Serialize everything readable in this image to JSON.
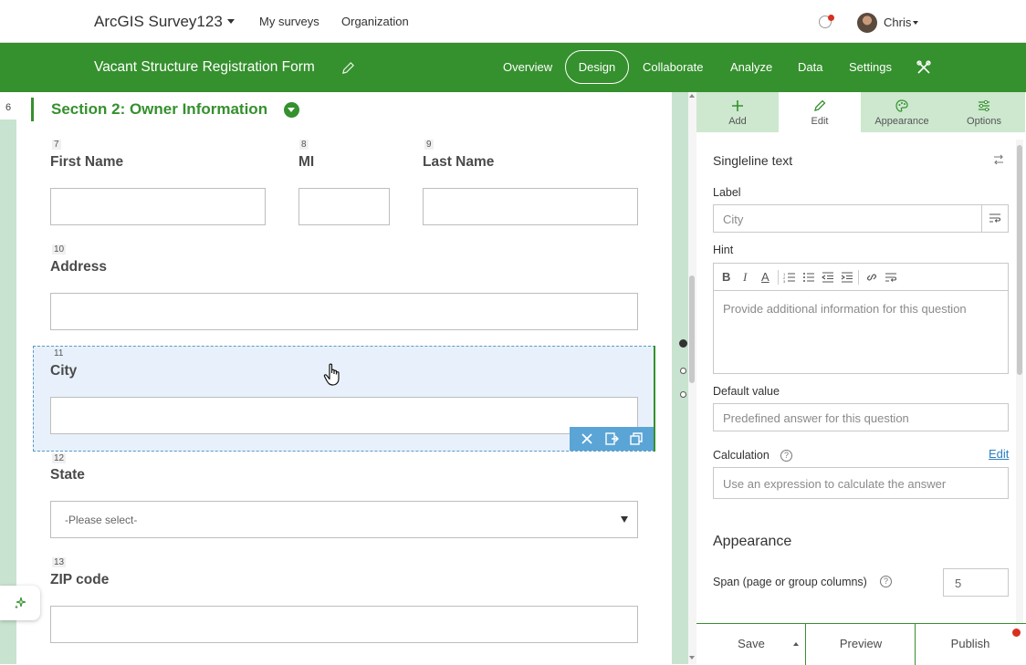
{
  "topbar": {
    "app_title": "ArcGIS Survey123",
    "nav": [
      "My surveys",
      "Organization"
    ],
    "user": "Chris"
  },
  "greenbar": {
    "form_title": "Vacant Structure Registration Form",
    "tabs": [
      "Overview",
      "Design",
      "Collaborate",
      "Analyze",
      "Data",
      "Settings"
    ],
    "active_tab": "Design"
  },
  "canvas": {
    "section_number": "6",
    "section_title": "Section 2: Owner Information",
    "questions": [
      {
        "num": "7",
        "label": "First Name"
      },
      {
        "num": "8",
        "label": "MI"
      },
      {
        "num": "9",
        "label": "Last Name"
      },
      {
        "num": "10",
        "label": "Address"
      },
      {
        "num": "11",
        "label": "City"
      },
      {
        "num": "12",
        "label": "State"
      },
      {
        "num": "13",
        "label": "ZIP code"
      }
    ],
    "state_placeholder": "-Please select-"
  },
  "panel": {
    "tabs": [
      "Add",
      "Edit",
      "Appearance",
      "Options"
    ],
    "active_tab": "Edit",
    "question_type": "Singleline text",
    "label_label": "Label",
    "label_placeholder": "City",
    "hint_label": "Hint",
    "hint_placeholder": "Provide additional information for this question",
    "default_label": "Default value",
    "default_placeholder": "Predefined answer for this question",
    "calc_label": "Calculation",
    "calc_edit": "Edit",
    "calc_placeholder": "Use an expression to calculate the answer",
    "appearance_heading": "Appearance",
    "span_label": "Span (page or group columns)",
    "span_value": "5",
    "rte_buttons": [
      "B",
      "I",
      "A"
    ],
    "bottom": [
      "Save",
      "Preview",
      "Publish"
    ]
  },
  "colors": {
    "brand_green": "#35902e",
    "selection_fill": "#e8f1fb",
    "selection_tools": "#5aa5d6",
    "link_blue": "#2a7fc1",
    "alert_red": "#d83020"
  }
}
